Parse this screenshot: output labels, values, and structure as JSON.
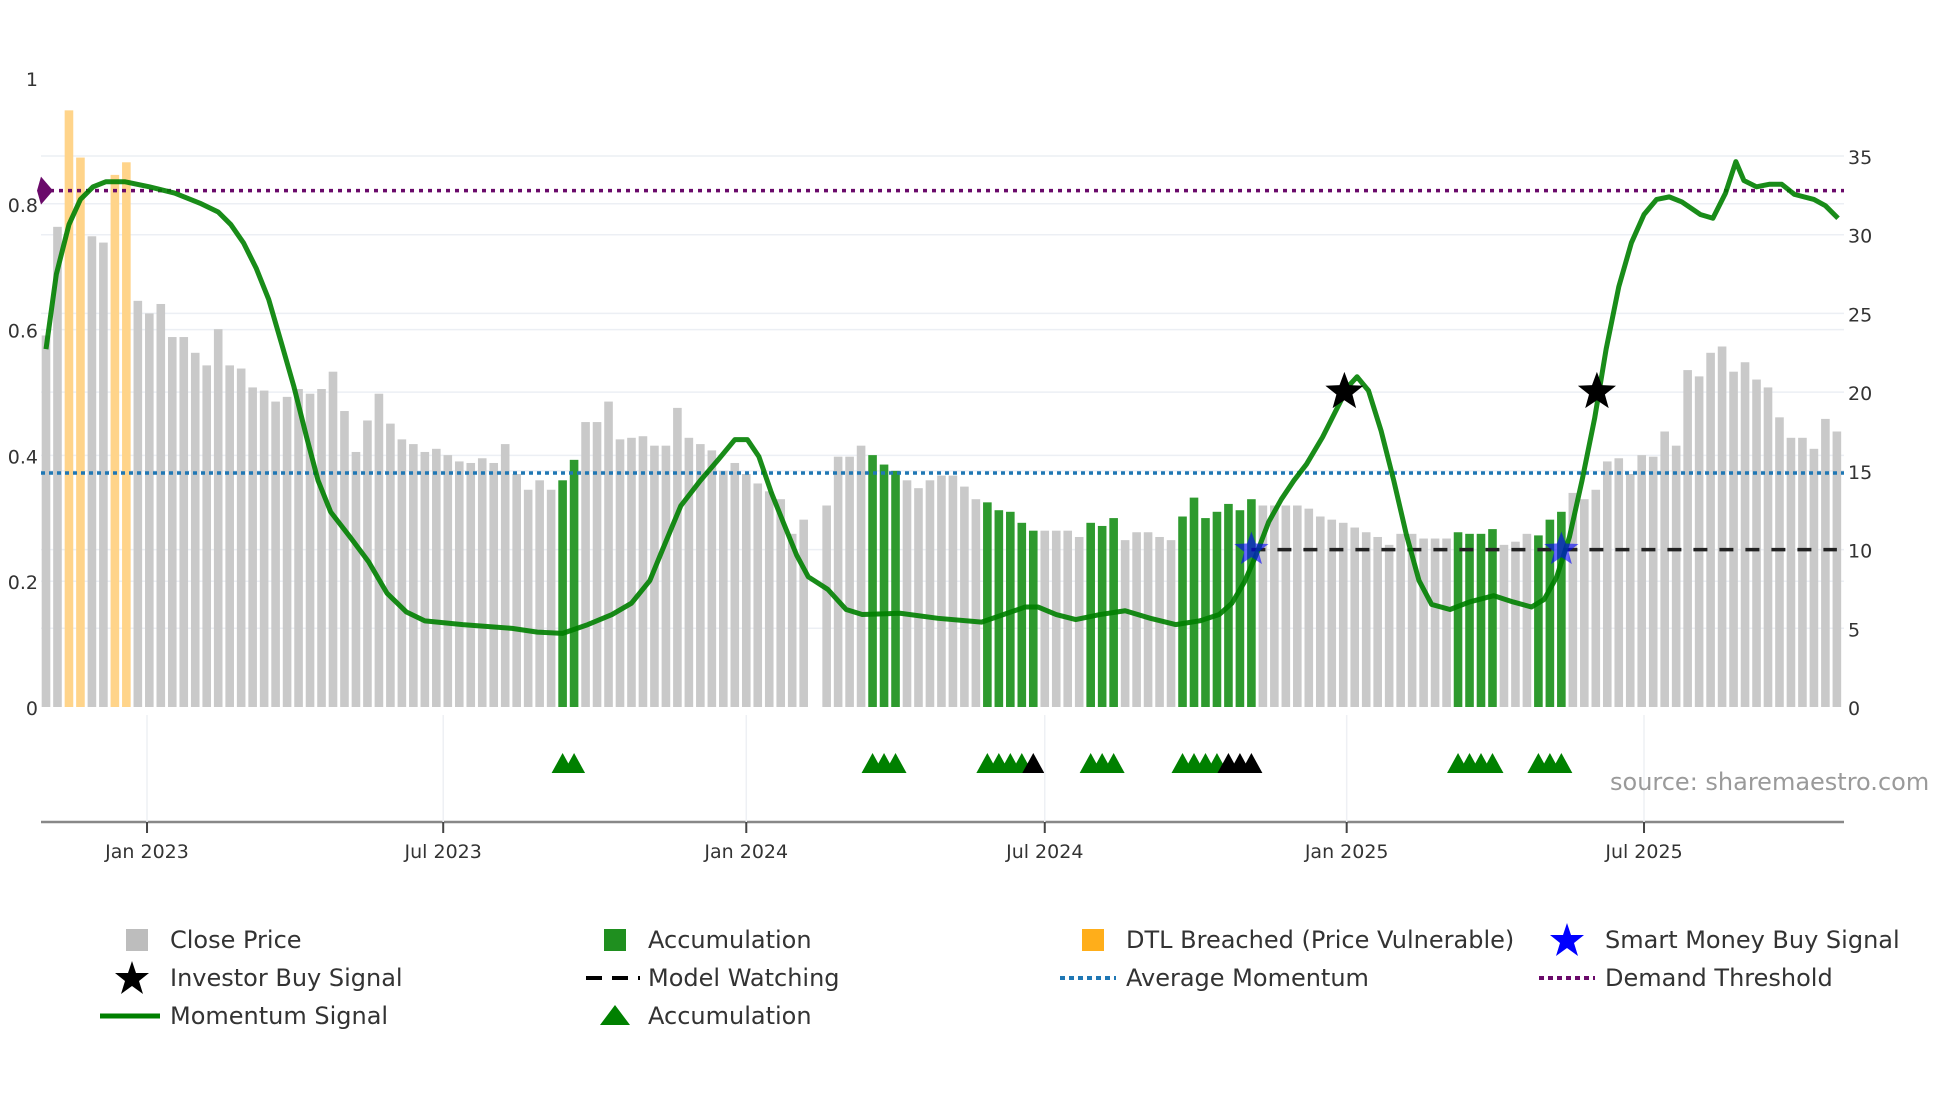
{
  "chart_data": {
    "type": "bar",
    "title": "",
    "x_unit": "week index",
    "bar_series": {
      "name": "Close Price",
      "axis": "right",
      "values": [
        23.6,
        30.5,
        37.9,
        34.9,
        29.9,
        29.5,
        33.8,
        34.6,
        25.8,
        25.0,
        25.6,
        23.5,
        23.5,
        22.5,
        21.7,
        24.0,
        21.7,
        21.5,
        20.3,
        20.1,
        19.4,
        19.7,
        20.2,
        19.9,
        20.2,
        21.3,
        18.8,
        16.2,
        18.2,
        19.9,
        18.0,
        17.0,
        16.7,
        16.2,
        16.4,
        16.0,
        15.6,
        15.5,
        15.8,
        15.5,
        16.7,
        14.8,
        13.8,
        14.4,
        13.8,
        14.4,
        15.7,
        18.1,
        18.1,
        19.4,
        17.0,
        17.1,
        17.2,
        16.6,
        16.6,
        19.0,
        17.1,
        16.7,
        16.3,
        15.0,
        15.5,
        14.8,
        14.2,
        13.7,
        13.2,
        11.0,
        11.9,
        0,
        12.8,
        15.9,
        15.9,
        16.6,
        16.0,
        15.4,
        15.0,
        14.4,
        13.9,
        14.4,
        14.7,
        14.7,
        14.0,
        13.2,
        13.0,
        12.5,
        12.4,
        11.7,
        11.2,
        11.2,
        11.2,
        11.2,
        10.8,
        11.7,
        11.5,
        12.0,
        10.6,
        11.1,
        11.1,
        10.8,
        10.6,
        12.1,
        13.3,
        12.0,
        12.4,
        12.9,
        12.5,
        13.2,
        12.8,
        12.8,
        12.8,
        12.8,
        12.6,
        12.1,
        11.9,
        11.7,
        11.4,
        11.1,
        10.8,
        10.3,
        11.0,
        11.0,
        10.7,
        10.7,
        10.7,
        11.1,
        11.0,
        11.0,
        11.3,
        10.3,
        10.5,
        11.0,
        10.9,
        11.9,
        12.4,
        13.6,
        13.2,
        13.8,
        15.6,
        15.8,
        14.8,
        16.0,
        15.9,
        17.5,
        16.6,
        21.4,
        21.0,
        22.5,
        22.9,
        21.3,
        21.9,
        20.8,
        20.3,
        18.4,
        17.1,
        17.1,
        16.4,
        18.3,
        17.5
      ]
    },
    "accumulation_ranges": [
      [
        45,
        46
      ],
      [
        72,
        74
      ],
      [
        82,
        86
      ],
      [
        91,
        93
      ],
      [
        99,
        105
      ],
      [
        123,
        126
      ],
      [
        130,
        132
      ]
    ],
    "dtl_breached_ranges": [
      [
        2,
        3
      ],
      [
        6,
        7
      ]
    ],
    "momentum_signal": [
      [
        0,
        0.569
      ],
      [
        0.9,
        0.688
      ],
      [
        2,
        0.767
      ],
      [
        3,
        0.807
      ],
      [
        4.1,
        0.827
      ],
      [
        5.2,
        0.835
      ],
      [
        6.9,
        0.835
      ],
      [
        9,
        0.827
      ],
      [
        11.2,
        0.817
      ],
      [
        13.4,
        0.801
      ],
      [
        15,
        0.787
      ],
      [
        16.1,
        0.767
      ],
      [
        17.2,
        0.738
      ],
      [
        18.3,
        0.698
      ],
      [
        19.4,
        0.648
      ],
      [
        20.5,
        0.579
      ],
      [
        21.6,
        0.509
      ],
      [
        22.7,
        0.429
      ],
      [
        23.7,
        0.36
      ],
      [
        24.8,
        0.31
      ],
      [
        26.5,
        0.27
      ],
      [
        28.1,
        0.231
      ],
      [
        29.7,
        0.181
      ],
      [
        31.4,
        0.151
      ],
      [
        33,
        0.137
      ],
      [
        36.3,
        0.131
      ],
      [
        40.6,
        0.125
      ],
      [
        42.8,
        0.119
      ],
      [
        45,
        0.117
      ],
      [
        47.2,
        0.131
      ],
      [
        49.3,
        0.147
      ],
      [
        51,
        0.165
      ],
      [
        52.6,
        0.201
      ],
      [
        53.7,
        0.25
      ],
      [
        55.3,
        0.32
      ],
      [
        57,
        0.36
      ],
      [
        58.6,
        0.394
      ],
      [
        60,
        0.425
      ],
      [
        61.1,
        0.425
      ],
      [
        62.1,
        0.398
      ],
      [
        63.2,
        0.34
      ],
      [
        64.3,
        0.29
      ],
      [
        65.4,
        0.241
      ],
      [
        66.4,
        0.207
      ],
      [
        68.1,
        0.187
      ],
      [
        69.7,
        0.155
      ],
      [
        71.1,
        0.147
      ],
      [
        74.4,
        0.149
      ],
      [
        77.7,
        0.141
      ],
      [
        81.5,
        0.135
      ],
      [
        83.1,
        0.145
      ],
      [
        85.3,
        0.159
      ],
      [
        86.4,
        0.159
      ],
      [
        88,
        0.147
      ],
      [
        89.7,
        0.139
      ],
      [
        91.8,
        0.147
      ],
      [
        94,
        0.153
      ],
      [
        96.2,
        0.141
      ],
      [
        98.4,
        0.131
      ],
      [
        100.5,
        0.137
      ],
      [
        102.2,
        0.147
      ],
      [
        103.3,
        0.165
      ],
      [
        104.4,
        0.199
      ],
      [
        105.4,
        0.241
      ],
      [
        106.5,
        0.294
      ],
      [
        107.6,
        0.33
      ],
      [
        108.7,
        0.36
      ],
      [
        109.8,
        0.386
      ],
      [
        111.2,
        0.429
      ],
      [
        112.3,
        0.469
      ],
      [
        113.4,
        0.509
      ],
      [
        114.2,
        0.525
      ],
      [
        115.2,
        0.503
      ],
      [
        116.3,
        0.439
      ],
      [
        117.4,
        0.36
      ],
      [
        118.5,
        0.274
      ],
      [
        119.6,
        0.201
      ],
      [
        120.7,
        0.163
      ],
      [
        122.3,
        0.155
      ],
      [
        124,
        0.167
      ],
      [
        126.1,
        0.177
      ],
      [
        127.8,
        0.167
      ],
      [
        129.4,
        0.159
      ],
      [
        130.5,
        0.171
      ],
      [
        131.6,
        0.207
      ],
      [
        132.7,
        0.27
      ],
      [
        133.8,
        0.36
      ],
      [
        134.9,
        0.459
      ],
      [
        135.9,
        0.569
      ],
      [
        137,
        0.668
      ],
      [
        138.1,
        0.738
      ],
      [
        139.2,
        0.783
      ],
      [
        140.3,
        0.807
      ],
      [
        141.4,
        0.811
      ],
      [
        142.5,
        0.803
      ],
      [
        144.1,
        0.783
      ],
      [
        145.2,
        0.777
      ],
      [
        146.3,
        0.817
      ],
      [
        147.2,
        0.867
      ],
      [
        147.9,
        0.837
      ],
      [
        149,
        0.827
      ],
      [
        150.1,
        0.831
      ],
      [
        151.2,
        0.831
      ],
      [
        152.3,
        0.815
      ],
      [
        154,
        0.807
      ],
      [
        155,
        0.797
      ],
      [
        156.1,
        0.777
      ]
    ],
    "average_momentum": 0.372,
    "demand_threshold": 0.821,
    "model_watching": {
      "from": 105,
      "to": 156,
      "value_right": 10
    },
    "investor_buy_signals": [
      [
        113.1,
        0.501
      ],
      [
        135.1,
        0.501
      ]
    ],
    "smart_money_buy_signals": [
      [
        105,
        10
      ],
      [
        132,
        10
      ]
    ],
    "accumulation_markers_green": [
      45,
      46,
      72,
      73,
      74,
      82,
      83,
      84,
      85,
      91,
      92,
      93,
      99,
      100,
      101,
      102,
      123,
      124,
      125,
      126,
      130,
      131,
      132
    ],
    "accumulation_markers_black": [
      86,
      103,
      104,
      105
    ],
    "left_axis": {
      "ylim": [
        0,
        1
      ],
      "ticks": [
        {
          "v": 0,
          "label": "0"
        },
        {
          "v": 0.2,
          "label": "0.2"
        },
        {
          "v": 0.4,
          "label": "0.4"
        },
        {
          "v": 0.6,
          "label": "0.6"
        },
        {
          "v": 0.8,
          "label": "0.8"
        },
        {
          "v": 1,
          "label": "1"
        }
      ]
    },
    "right_axis": {
      "ylim": [
        0,
        35
      ],
      "ticks": [
        {
          "v": 0,
          "label": "0"
        },
        {
          "v": 5,
          "label": "5"
        },
        {
          "v": 10,
          "label": "10"
        },
        {
          "v": 15,
          "label": "15"
        },
        {
          "v": 20,
          "label": "20"
        },
        {
          "v": 25,
          "label": "25"
        },
        {
          "v": 30,
          "label": "30"
        },
        {
          "v": 35,
          "label": "35"
        }
      ]
    },
    "x_ticks": [
      {
        "w": 8.8,
        "label": "Jan 2023"
      },
      {
        "w": 34.6,
        "label": "Jul 2023"
      },
      {
        "w": 61,
        "label": "Jan 2024"
      },
      {
        "w": 87,
        "label": "Jul 2024"
      },
      {
        "w": 113.3,
        "label": "Jan 2025"
      },
      {
        "w": 139.2,
        "label": "Jul 2025"
      }
    ],
    "legend_placement": "bottom",
    "colors": {
      "price": "#c9c9c9",
      "accumulation": "#2e9a2e",
      "dtl": "#ffd48a",
      "momentum": "#008000",
      "avg": "#1f77b4",
      "demand": "#6a0a6a",
      "smart": "#0000ff",
      "investor": "#000000"
    }
  },
  "legend": [
    {
      "label": "Close Price"
    },
    {
      "label": "Accumulation"
    },
    {
      "label": "DTL Breached (Price Vulnerable)"
    },
    {
      "label": "Smart Money Buy Signal"
    },
    {
      "label": "Investor Buy Signal"
    },
    {
      "label": "Model Watching"
    },
    {
      "label": "Average Momentum"
    },
    {
      "label": "Demand Threshold"
    },
    {
      "label": "Momentum Signal"
    },
    {
      "label": "Accumulation"
    }
  ],
  "source": "source: sharemaestro.com"
}
